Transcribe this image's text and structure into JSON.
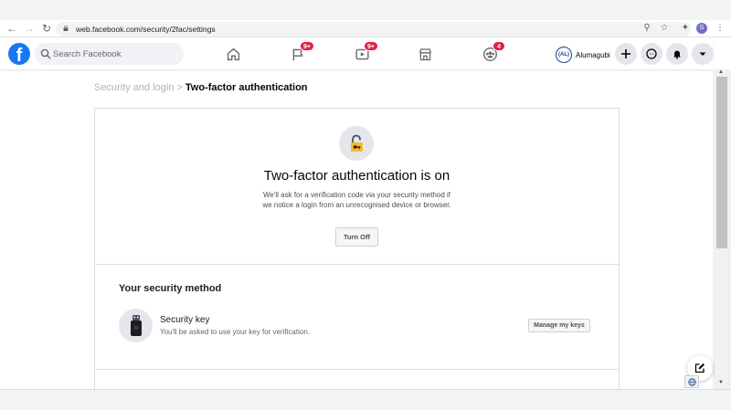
{
  "browser": {
    "url": "web.facebook.com/security/2fac/settings",
    "profile_initial": "S"
  },
  "header": {
    "logo": "f",
    "search_placeholder": "Search Facebook",
    "nav": [
      {
        "name": "home",
        "icon": "home-icon",
        "badge": ""
      },
      {
        "name": "pages",
        "icon": "flag-icon",
        "badge": "9+"
      },
      {
        "name": "watch",
        "icon": "video-icon",
        "badge": "9+"
      },
      {
        "name": "marketplace",
        "icon": "store-icon",
        "badge": ""
      },
      {
        "name": "groups",
        "icon": "groups-icon",
        "badge": "4"
      }
    ],
    "profile": {
      "avatar_text": "(AL)",
      "name": "Alumagubi"
    }
  },
  "breadcrumb": {
    "parent": "Security and login",
    "separator": ">",
    "current": "Two-factor authentication"
  },
  "status": {
    "title": "Two-factor authentication is on",
    "description": "We'll ask for a verification code via your security method if we notice a login from an unrecognised device or browser.",
    "turn_off_label": "Turn Off"
  },
  "security_method": {
    "section_title": "Your security method",
    "method_name": "Security key",
    "method_description": "You'll be asked to use your key for verification.",
    "manage_label": "Manage my keys"
  },
  "colors": {
    "brand": "#1877f2",
    "badge": "#e41e3f",
    "lock": "#f7b928"
  }
}
